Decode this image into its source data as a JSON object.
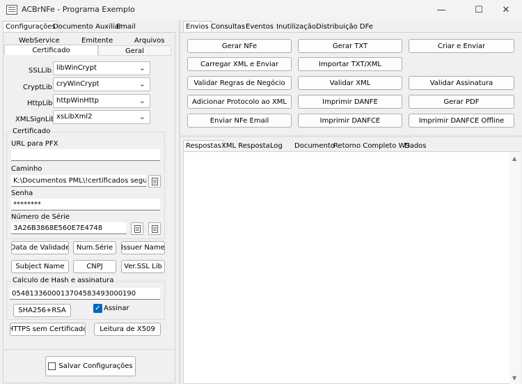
{
  "window": {
    "title": "ACBrNFe - Programa Exemplo",
    "controls": {
      "minimize": "—",
      "maximize": "☐",
      "close": "✕"
    }
  },
  "left": {
    "tabs_row1": [
      "Configurações",
      "Documento Auxiliar",
      "Email"
    ],
    "tabs_row2": [
      "WebService",
      "Emitente",
      "Arquivos"
    ],
    "tabs_row3": [
      "Certificado",
      "Geral"
    ],
    "libs": [
      {
        "label": "SSLLib",
        "value": "libWinCrypt"
      },
      {
        "label": "CryptLib",
        "value": "cryWinCrypt"
      },
      {
        "label": "HttpLib",
        "value": "httpWinHttp"
      },
      {
        "label": "XMLSignLib",
        "value": "xsLibXml2"
      }
    ],
    "certificado": {
      "group_title": "Certificado",
      "url_label": "URL para PFX",
      "url_value": "",
      "caminho_label": "Caminho",
      "caminho_value": "K:\\Documentos PML\\!certificados seguranca P",
      "senha_label": "Senha",
      "senha_value": "********",
      "serie_label": "Número de Série",
      "serie_value": "3A26B3868E560E7E4748"
    },
    "cert_buttons": [
      "Data de Validade",
      "Num.Série",
      "Issuer Name",
      "Subject Name",
      "CNPJ",
      "Ver.SSL Lib"
    ],
    "hash": {
      "group_title": "Calculo de Hash e assinatura",
      "value": "05481336000137045834930001‍90",
      "sha_button": "SHA256+RSA",
      "assinar_label": "Assinar",
      "assinar_checked": true
    },
    "bottom_buttons": [
      "HTTPS sem Certificado",
      "Leitura de X509"
    ],
    "save_button": "Salvar Configurações"
  },
  "right": {
    "tabs": [
      "Envios",
      "Consultas",
      "Eventos",
      "Inutilização",
      "Distribuição DFe"
    ],
    "buttons": [
      [
        "Gerar NFe",
        "Gerar TXT",
        "Criar e Enviar"
      ],
      [
        "Carregar XML e Enviar",
        "Importar TXT/XML",
        ""
      ],
      [
        "Validar Regras de Negócio",
        "Validar XML",
        "Validar Assinatura"
      ],
      [
        "Adicionar Protocolo ao XML",
        "Imprimir DANFE",
        "Gerar PDF"
      ],
      [
        "Enviar NFe Email",
        "Imprimir DANFCE",
        "Imprimir DANFCE Offline"
      ]
    ],
    "response_tabs": [
      "Respostas",
      "XML Resposta",
      "Log",
      "Documento",
      "Retorno Completo WS",
      "Dados"
    ]
  },
  "colors": {
    "accent": "#0067c0",
    "background": "#f0f0f0"
  }
}
